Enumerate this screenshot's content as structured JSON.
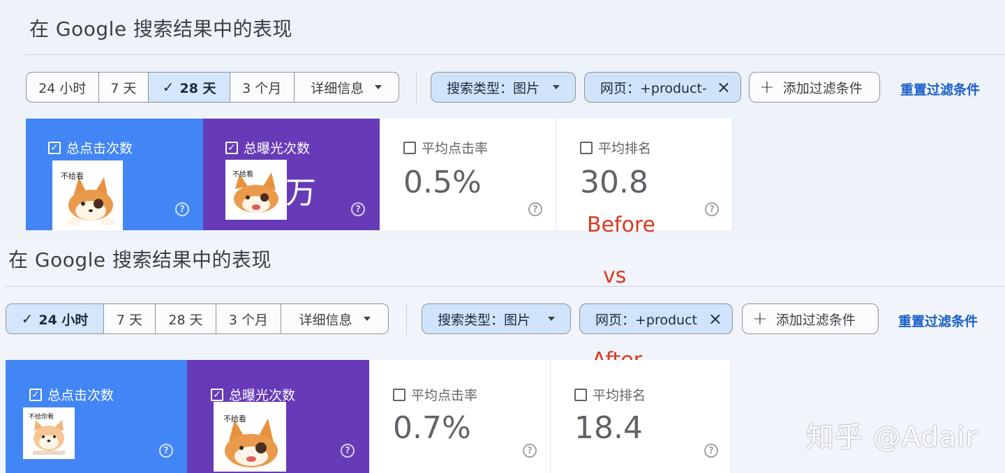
{
  "before": {
    "title": "在 Google 搜索结果中的表现",
    "date_range": [
      "24 小时",
      "7 天",
      "28 天",
      "3 个月",
      "详细信息"
    ],
    "selected_range": "28 天",
    "filters": {
      "search_type": "搜索类型：图片",
      "page": "网页：+product-",
      "add_filter": "添加过滤条件",
      "reset": "重置过滤条件"
    },
    "metrics": [
      {
        "label": "总点击次数",
        "value": "",
        "checked": true
      },
      {
        "label": "总曝光次数",
        "value": "万",
        "checked": true
      },
      {
        "label": "平均点击率",
        "value": "0.5%",
        "checked": false
      },
      {
        "label": "平均排名",
        "value": "30.8",
        "checked": false
      }
    ],
    "sticker_text": "不给看"
  },
  "after": {
    "title": "在 Google 搜索结果中的表现",
    "date_range": [
      "24 小时",
      "7 天",
      "28 天",
      "3 个月",
      "详细信息"
    ],
    "selected_range": "24 小时",
    "filters": {
      "search_type": "搜索类型：图片",
      "page": "网页：+product",
      "add_filter": "添加过滤条件",
      "reset": "重置过滤条件"
    },
    "metrics": [
      {
        "label": "总点击次数",
        "value": "",
        "checked": true
      },
      {
        "label": "总曝光次数",
        "value": "",
        "checked": true
      },
      {
        "label": "平均点击率",
        "value": "0.7%",
        "checked": false
      },
      {
        "label": "平均排名",
        "value": "18.4",
        "checked": false
      }
    ],
    "sticker_text_1": "不给你看",
    "sticker_text_2": "不给看"
  },
  "annotations": {
    "before": "Before",
    "vs": "vs",
    "after": "After"
  },
  "watermark": "知乎 @Adair",
  "colors": {
    "clicks": "#4285f4",
    "impressions": "#673ab7",
    "selected_chip": "#d4e6fb",
    "link": "#1a5fc7",
    "annotation": "#d83a1f"
  }
}
